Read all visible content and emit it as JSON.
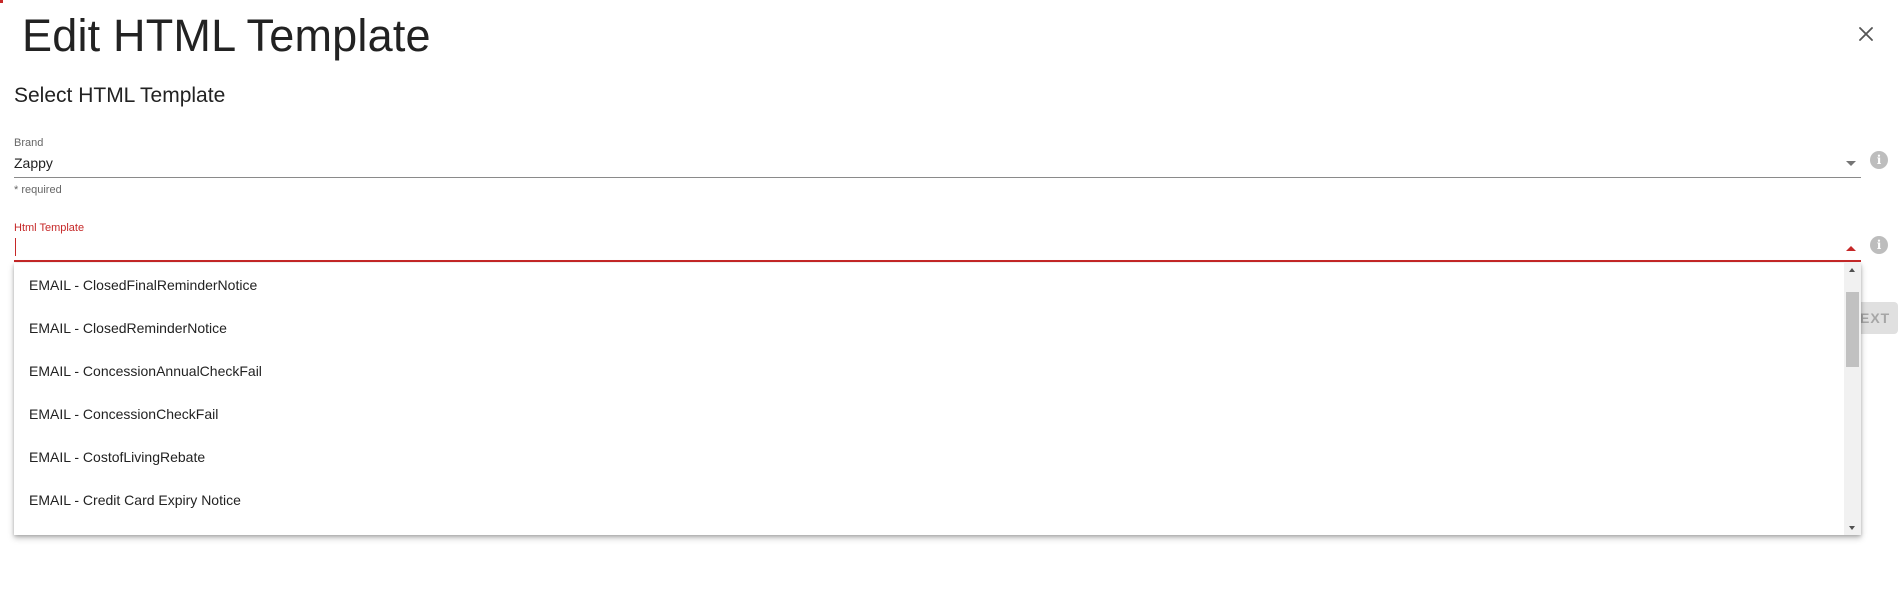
{
  "dialog": {
    "title": "Edit HTML Template",
    "subtitle": "Select HTML Template",
    "close_icon": "close-icon"
  },
  "brand_field": {
    "label": "Brand",
    "value": "Zappy",
    "hint": "* required",
    "info_icon": "info-icon"
  },
  "template_field": {
    "label": "Html Template",
    "value": "",
    "info_icon": "info-icon"
  },
  "dropdown": {
    "options": [
      "EMAIL - ClosedFinalReminderNotice",
      "EMAIL - ClosedReminderNotice",
      "EMAIL - ConcessionAnnualCheckFail",
      "EMAIL - ConcessionCheckFail",
      "EMAIL - CostofLivingRebate",
      "EMAIL - Credit Card Expiry Notice"
    ]
  },
  "actions": {
    "next_label": "EXT"
  },
  "colors": {
    "accent": "#c62828",
    "text": "#222222",
    "muted": "#666666",
    "disabled_button": "#e0e0e0"
  }
}
